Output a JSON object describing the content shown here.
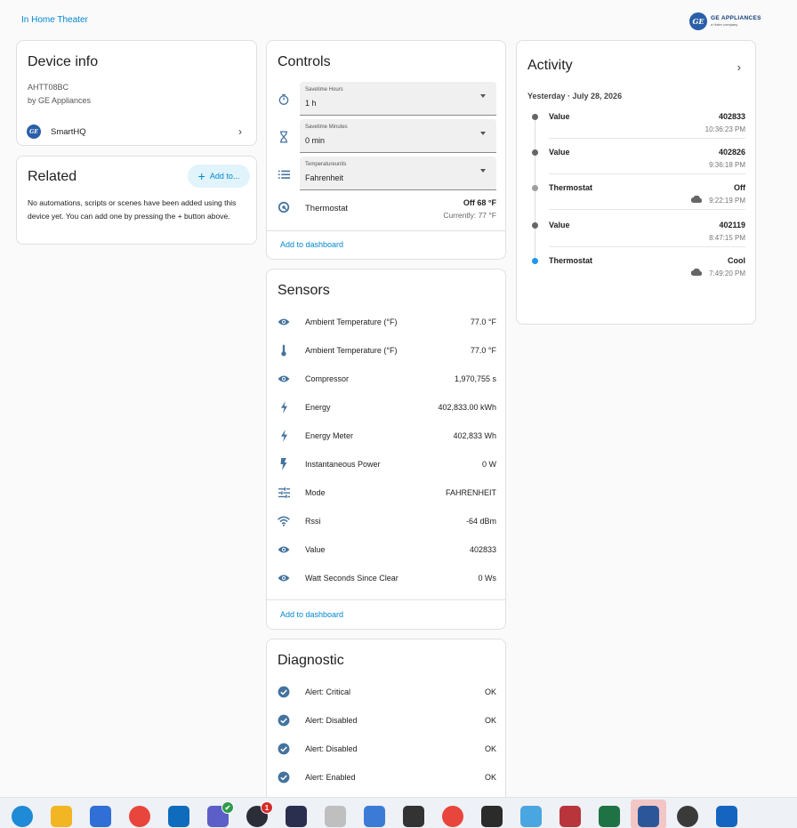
{
  "breadcrumb": "In Home Theater",
  "brand": {
    "name": "GE APPLIANCES",
    "sub": "a Haier company",
    "logo": "ge"
  },
  "device_info": {
    "title": "Device info",
    "model": "AHTT08BC",
    "manufacturer": "by GE Appliances",
    "integration": "SmartHQ"
  },
  "related": {
    "title": "Related",
    "add_label": "Add to...",
    "text": "No automations, scripts or scenes have been added using this device yet. You can add one by pressing the + button above."
  },
  "controls": {
    "title": "Controls",
    "selects": [
      {
        "label": "Savetime Hours",
        "value": "1 h",
        "icon": "timer-icon"
      },
      {
        "label": "Savetime Minutes",
        "value": "0 min",
        "icon": "hourglass-icon"
      },
      {
        "label": "Temperatureunits",
        "value": "Fahrenheit",
        "icon": "list-icon"
      }
    ],
    "thermostat": {
      "name": "Thermostat",
      "state": "Off 68 °F",
      "current": "Currently: 77 °F"
    },
    "add_to_dashboard": "Add to dashboard"
  },
  "sensors": {
    "title": "Sensors",
    "items": [
      {
        "name": "Ambient Temperature (°F)",
        "value": "77.0 °F",
        "icon": "eye-icon"
      },
      {
        "name": "Ambient Temperature (°F)",
        "value": "77.0 °F",
        "icon": "thermometer-icon"
      },
      {
        "name": "Compressor",
        "value": "1,970,755 s",
        "icon": "eye-icon"
      },
      {
        "name": "Energy",
        "value": "402,833.00 kWh",
        "icon": "lightning-icon"
      },
      {
        "name": "Energy Meter",
        "value": "402,833 Wh",
        "icon": "lightning-icon"
      },
      {
        "name": "Instantaneous Power",
        "value": "0 W",
        "icon": "flash-icon"
      },
      {
        "name": "Mode",
        "value": "FAHRENHEIT",
        "icon": "tune-icon"
      },
      {
        "name": "Rssi",
        "value": "-64 dBm",
        "icon": "wifi-icon"
      },
      {
        "name": "Value",
        "value": "402833",
        "icon": "eye-icon"
      },
      {
        "name": "Watt Seconds Since Clear",
        "value": "0 Ws",
        "icon": "eye-icon"
      }
    ],
    "add_to_dashboard": "Add to dashboard"
  },
  "diagnostic": {
    "title": "Diagnostic",
    "items": [
      {
        "name": "Alert: Critical",
        "value": "OK"
      },
      {
        "name": "Alert: Disabled",
        "value": "OK"
      },
      {
        "name": "Alert: Disabled",
        "value": "OK"
      },
      {
        "name": "Alert: Enabled",
        "value": "OK"
      }
    ]
  },
  "activity": {
    "title": "Activity",
    "date": "Yesterday · July 28, 2026",
    "items": [
      {
        "name": "Value",
        "value": "402833",
        "time": "10:36:23 PM",
        "cloud": false,
        "dot": "#666666"
      },
      {
        "name": "Value",
        "value": "402826",
        "time": "9:36:18 PM",
        "cloud": false,
        "dot": "#666666"
      },
      {
        "name": "Thermostat",
        "value": "Off",
        "time": "9:22:19 PM",
        "cloud": true,
        "dot": "#9e9e9e"
      },
      {
        "name": "Value",
        "value": "402119",
        "time": "8:47:15 PM",
        "cloud": false,
        "dot": "#666666"
      },
      {
        "name": "Thermostat",
        "value": "Cool",
        "time": "7:49:20 PM",
        "cloud": true,
        "dot": "#2196f3"
      }
    ]
  },
  "taskbar": {
    "apps": [
      {
        "name": "edge-icon",
        "color": "#1f8ad6"
      },
      {
        "name": "file-explorer-icon",
        "color": "#f2b624"
      },
      {
        "name": "store-icon",
        "color": "#2f6fd6"
      },
      {
        "name": "chrome-icon",
        "color": "#e8453c"
      },
      {
        "name": "outlook-icon",
        "color": "#0f6cbd"
      },
      {
        "name": "teams-icon",
        "color": "#5b5fc7",
        "badge": "✔"
      },
      {
        "name": "app-circle-icon",
        "color": "#2d2d3a",
        "badge": "1"
      },
      {
        "name": "wave-app-icon",
        "color": "#2a2f4f"
      },
      {
        "name": "dsp-icon",
        "color": "#bfbfbf"
      },
      {
        "name": "notepad-icon",
        "color": "#3b7bd6"
      },
      {
        "name": "terminal-window-icon",
        "color": "#333333"
      },
      {
        "name": "chrome-profile-icon",
        "color": "#e8453c"
      },
      {
        "name": "terminal-icon",
        "color": "#2b2b2b"
      },
      {
        "name": "paint-icon",
        "color": "#4aa6e0"
      },
      {
        "name": "access-icon",
        "color": "#b8353b"
      },
      {
        "name": "excel-icon",
        "color": "#1f7244"
      },
      {
        "name": "word-icon",
        "color": "#2b579a"
      },
      {
        "name": "speed-icon",
        "color": "#3a3a3a"
      },
      {
        "name": "download-icon",
        "color": "#1565c0"
      }
    ]
  }
}
